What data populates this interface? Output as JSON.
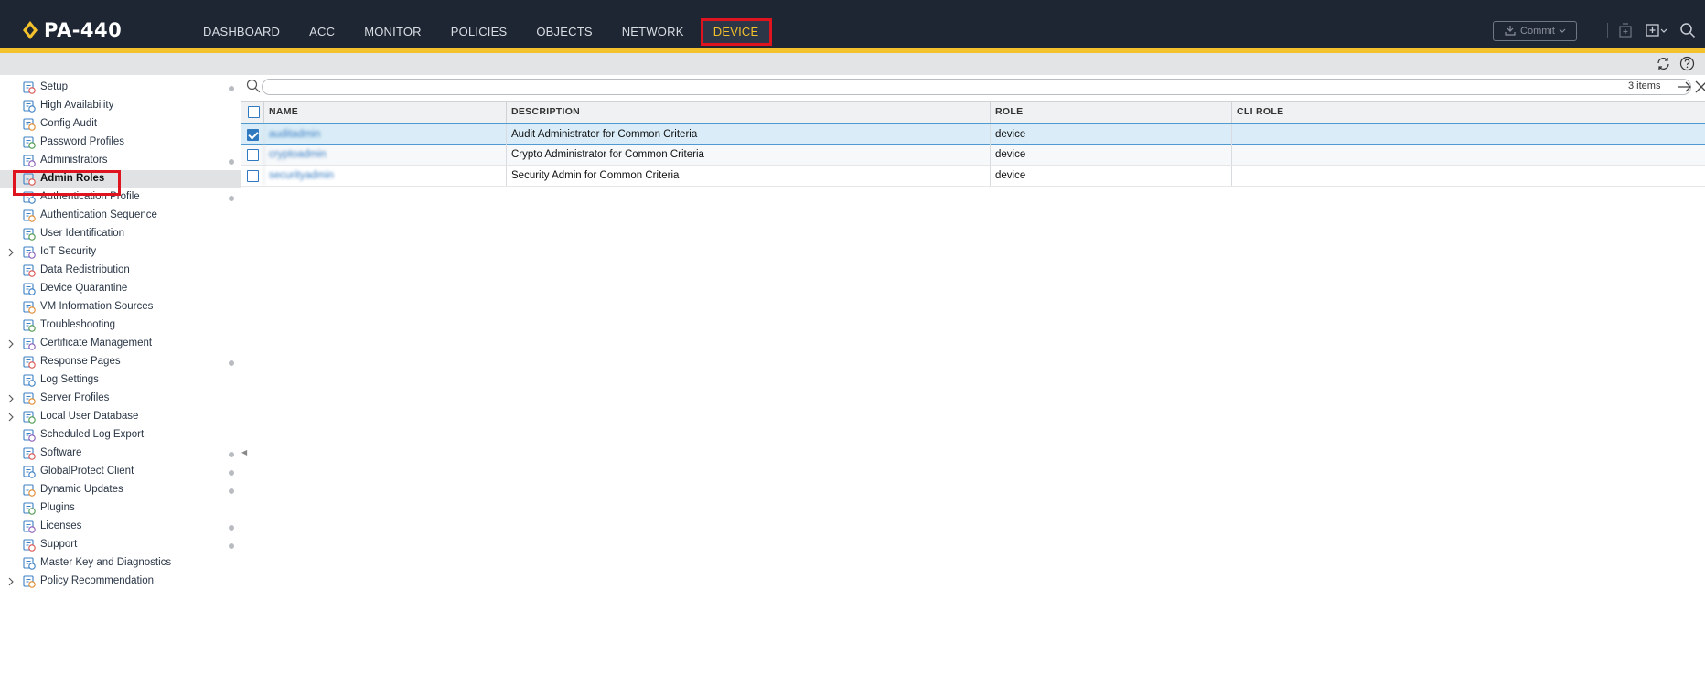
{
  "app": {
    "title": "PA-440",
    "brand_color": "#f3c12b",
    "topbar_color": "#1f2633"
  },
  "nav": {
    "items": [
      {
        "label": "DASHBOARD",
        "active": false
      },
      {
        "label": "ACC",
        "active": false
      },
      {
        "label": "MONITOR",
        "active": false
      },
      {
        "label": "POLICIES",
        "active": false
      },
      {
        "label": "OBJECTS",
        "active": false
      },
      {
        "label": "NETWORK",
        "active": false
      },
      {
        "label": "DEVICE",
        "active": true
      }
    ]
  },
  "toolbar": {
    "commit_label": "Commit",
    "icons": [
      "lock-icon",
      "config-icon",
      "search-icon"
    ]
  },
  "subbar": {
    "icons": [
      "refresh-icon",
      "help-icon"
    ]
  },
  "sidebar": {
    "items": [
      {
        "label": "Setup",
        "icon": "setup-icon",
        "expandable": false,
        "dot": true,
        "selected": false
      },
      {
        "label": "High Availability",
        "icon": "ha-icon",
        "expandable": false,
        "dot": false,
        "selected": false
      },
      {
        "label": "Config Audit",
        "icon": "audit-icon",
        "expandable": false,
        "dot": false,
        "selected": false
      },
      {
        "label": "Password Profiles",
        "icon": "password-icon",
        "expandable": false,
        "dot": false,
        "selected": false
      },
      {
        "label": "Administrators",
        "icon": "admin-icon",
        "expandable": false,
        "dot": true,
        "selected": false
      },
      {
        "label": "Admin Roles",
        "icon": "admin-roles-icon",
        "expandable": false,
        "dot": false,
        "selected": true
      },
      {
        "label": "Authentication Profile",
        "icon": "auth-profile-icon",
        "expandable": false,
        "dot": true,
        "selected": false
      },
      {
        "label": "Authentication Sequence",
        "icon": "auth-sequence-icon",
        "expandable": false,
        "dot": false,
        "selected": false
      },
      {
        "label": "User Identification",
        "icon": "user-id-icon",
        "expandable": false,
        "dot": false,
        "selected": false
      },
      {
        "label": "IoT Security",
        "icon": "iot-icon",
        "expandable": true,
        "dot": false,
        "selected": false
      },
      {
        "label": "Data Redistribution",
        "icon": "redistribution-icon",
        "expandable": false,
        "dot": false,
        "selected": false
      },
      {
        "label": "Device Quarantine",
        "icon": "quarantine-icon",
        "expandable": false,
        "dot": false,
        "selected": false
      },
      {
        "label": "VM Information Sources",
        "icon": "vm-icon",
        "expandable": false,
        "dot": false,
        "selected": false
      },
      {
        "label": "Troubleshooting",
        "icon": "troubleshooting-icon",
        "expandable": false,
        "dot": false,
        "selected": false
      },
      {
        "label": "Certificate Management",
        "icon": "certificate-icon",
        "expandable": true,
        "dot": false,
        "selected": false
      },
      {
        "label": "Response Pages",
        "icon": "response-pages-icon",
        "expandable": false,
        "dot": true,
        "selected": false
      },
      {
        "label": "Log Settings",
        "icon": "log-settings-icon",
        "expandable": false,
        "dot": false,
        "selected": false
      },
      {
        "label": "Server Profiles",
        "icon": "server-profiles-icon",
        "expandable": true,
        "dot": false,
        "selected": false
      },
      {
        "label": "Local User Database",
        "icon": "user-database-icon",
        "expandable": true,
        "dot": false,
        "selected": false
      },
      {
        "label": "Scheduled Log Export",
        "icon": "log-export-icon",
        "expandable": false,
        "dot": false,
        "selected": false
      },
      {
        "label": "Software",
        "icon": "software-icon",
        "expandable": false,
        "dot": true,
        "selected": false
      },
      {
        "label": "GlobalProtect Client",
        "icon": "globalprotect-icon",
        "expandable": false,
        "dot": true,
        "selected": false
      },
      {
        "label": "Dynamic Updates",
        "icon": "dynamic-updates-icon",
        "expandable": false,
        "dot": true,
        "selected": false
      },
      {
        "label": "Plugins",
        "icon": "plugins-icon",
        "expandable": false,
        "dot": false,
        "selected": false
      },
      {
        "label": "Licenses",
        "icon": "licenses-icon",
        "expandable": false,
        "dot": true,
        "selected": false
      },
      {
        "label": "Support",
        "icon": "support-icon",
        "expandable": false,
        "dot": true,
        "selected": false
      },
      {
        "label": "Master Key and Diagnostics",
        "icon": "master-key-icon",
        "expandable": false,
        "dot": false,
        "selected": false
      },
      {
        "label": "Policy Recommendation",
        "icon": "policy-recommendation-icon",
        "expandable": true,
        "dot": false,
        "selected": false
      }
    ]
  },
  "search": {
    "value": "",
    "placeholder": "",
    "items_count": "3 items"
  },
  "table": {
    "columns": [
      "NAME",
      "DESCRIPTION",
      "ROLE",
      "CLI ROLE"
    ],
    "rows": [
      {
        "name": "auditadmin",
        "description": "Audit Administrator for Common Criteria",
        "role": "device",
        "cli_role": "",
        "checked": true
      },
      {
        "name": "cryptoadmin",
        "description": "Crypto Administrator for Common Criteria",
        "role": "device",
        "cli_role": "",
        "checked": false
      },
      {
        "name": "securityadmin",
        "description": "Security Admin for Common Criteria",
        "role": "device",
        "cli_role": "",
        "checked": false
      }
    ]
  }
}
